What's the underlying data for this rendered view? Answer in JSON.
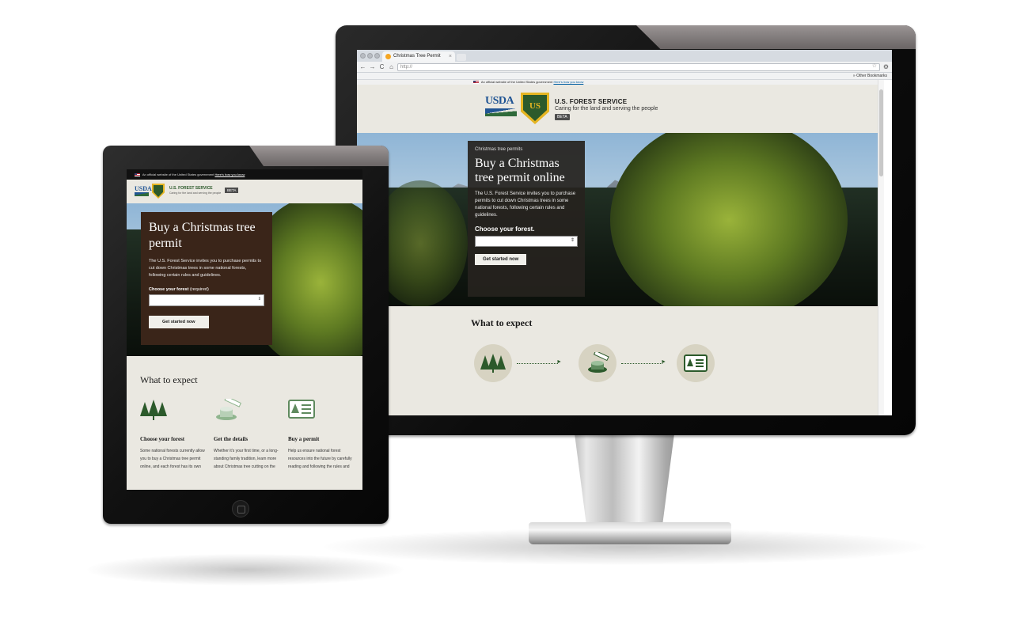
{
  "browser": {
    "tab_title": "Christmas Tree Permit",
    "tab_close": "×",
    "url": "http://",
    "bookmarks_label": "» Other Bookmarks",
    "back": "←",
    "forward": "→",
    "reload": "C",
    "home": "⌂",
    "star": "☆"
  },
  "gov_banner": {
    "text": "An official website of the United States government",
    "link": "Here's how you know"
  },
  "header": {
    "usda": "USDA",
    "shield_text": "US",
    "agency": "U.S. FOREST SERVICE",
    "tagline": "Caring for the land and serving the people",
    "beta": "BETA"
  },
  "hero": {
    "eyebrow": "Christmas tree permits",
    "title_desktop": "Buy a Christmas tree permit online",
    "title_tablet": "Buy a Christmas tree permit",
    "body_desktop": "The U.S. Forest Service invites you to purchase permits to cut down Christmas trees in some national forests, following certain rules and guidelines.",
    "body_tablet": "The U.S. Forest Service invites you to purchase permits to cut down Christmas trees in some national forests, following certain rules and guidelines.",
    "label_desktop": "Choose your forest.",
    "label_tablet": "Choose your forest",
    "label_tablet_required": "(required)",
    "select_value": "",
    "select_arrow": "⇕",
    "button": "Get started now"
  },
  "expect": {
    "title": "What to expect",
    "steps": [
      {
        "title": "Choose your forest",
        "body": "Some national forests currently allow you to buy a Christmas tree permit online, and each forest has its own",
        "icon": "trees-icon"
      },
      {
        "title": "Get the details",
        "body": "Whether it's your first time, or a long-standing family tradition, learn more about Christmas tree cutting on the",
        "icon": "stump-saw-icon"
      },
      {
        "title": "Buy a permit",
        "body": "Help us ensure national forest resources into the future by carefully reading and following the rules and",
        "icon": "permit-card-icon"
      }
    ]
  },
  "colors": {
    "forest_green": "#2c5a2b",
    "usda_blue": "#205493",
    "shield_gold": "#e5b522",
    "page_bg": "#eae8e1",
    "card_dark": "#3a2519"
  }
}
